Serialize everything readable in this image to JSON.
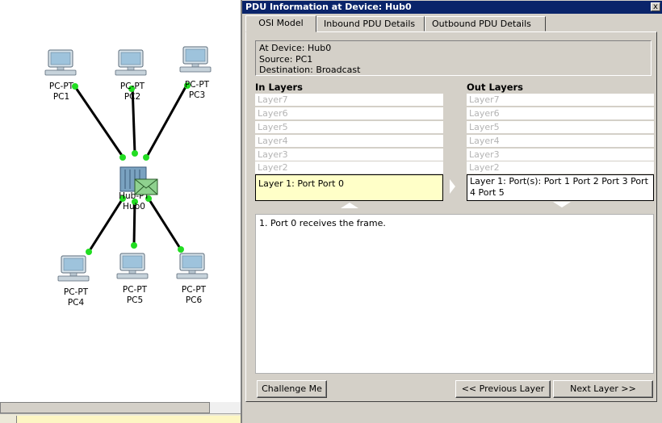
{
  "topology": {
    "devices": [
      {
        "id": "pc1",
        "type_label": "PC-PT",
        "name": "PC1"
      },
      {
        "id": "pc2",
        "type_label": "PC-PT",
        "name": "PC2"
      },
      {
        "id": "pc3",
        "type_label": "PC-PT",
        "name": "PC3"
      },
      {
        "id": "hub",
        "type_label": "Hub-PT",
        "name": "Hub0"
      },
      {
        "id": "pc4",
        "type_label": "PC-PT",
        "name": "PC4"
      },
      {
        "id": "pc5",
        "type_label": "PC-PT",
        "name": "PC5"
      },
      {
        "id": "pc6",
        "type_label": "PC-PT",
        "name": "PC6"
      }
    ],
    "link_status_color": "#22dd22",
    "pdu_envelope_color": "#8fd18f"
  },
  "dialog": {
    "title": "PDU Information at Device: Hub0",
    "close_label": "x",
    "tabs": [
      "OSI Model",
      "Inbound PDU Details",
      "Outbound PDU Details"
    ],
    "info": {
      "device": "At Device: Hub0",
      "source": "Source: PC1",
      "destination": "Destination: Broadcast"
    },
    "in_layers": {
      "heading": "In Layers",
      "layers": [
        "Layer7",
        "Layer6",
        "Layer5",
        "Layer4",
        "Layer3",
        "Layer2"
      ],
      "layer1": "Layer 1: Port Port 0"
    },
    "out_layers": {
      "heading": "Out Layers",
      "layers": [
        "Layer7",
        "Layer6",
        "Layer5",
        "Layer4",
        "Layer3",
        "Layer2"
      ],
      "layer1": "Layer 1: Port(s): Port 1 Port 2 Port 3 Port 4 Port 5"
    },
    "description": "1. Port 0 receives the frame.",
    "buttons": {
      "challenge": "Challenge Me",
      "previous": "<< Previous Layer",
      "next": "Next Layer >>"
    }
  }
}
